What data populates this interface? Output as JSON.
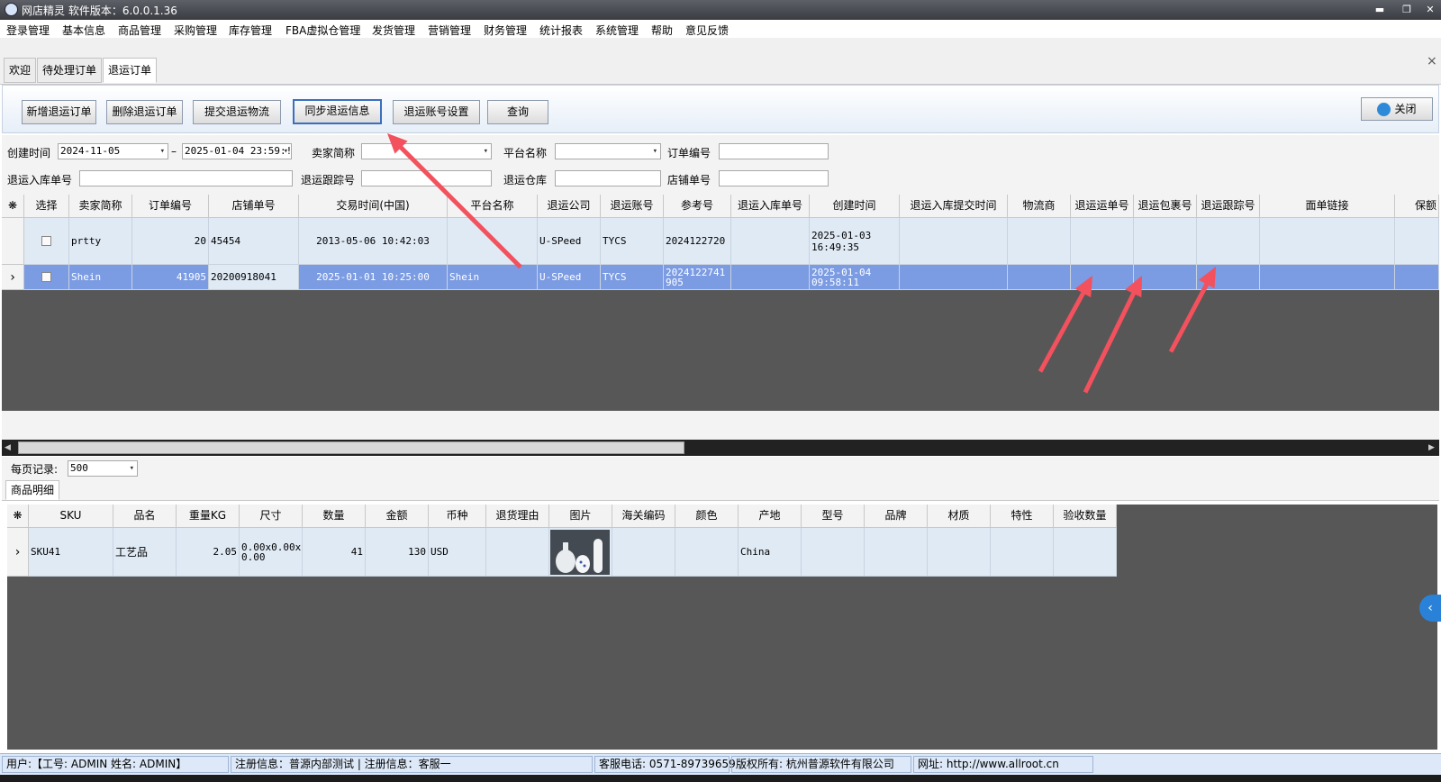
{
  "window": {
    "title": "网店精灵 软件版本：6.0.0.1.36",
    "min": "▬",
    "max": "❐",
    "close": "✕"
  },
  "menu": [
    "登录管理",
    "基本信息",
    "商品管理",
    "采购管理",
    "库存管理",
    "FBA虚拟仓管理",
    "发货管理",
    "营销管理",
    "财务管理",
    "统计报表",
    "系统管理",
    "帮助",
    "意见反馈"
  ],
  "tabs": [
    "欢迎",
    "待处理订单",
    "退运订单"
  ],
  "tab_close": "×",
  "toolbar": {
    "buttons": [
      "新增退运订单",
      "删除退运订单",
      "提交退运物流",
      "同步退运信息",
      "退运账号设置",
      "查询"
    ],
    "close_label": "关闭"
  },
  "filters": {
    "created_label": "创建时间",
    "date_from": "2024-11-05",
    "date_sep": "–",
    "date_to": "2025-01-04 23:59:!",
    "seller_label": "卖家简称",
    "seller_value": "",
    "platform_label": "平台名称",
    "platform_value": "",
    "order_no_label": "订单编号",
    "order_no_value": "",
    "return_in_label": "退运入库单号",
    "return_in_value": "",
    "track_label": "退运跟踪号",
    "track_value": "",
    "warehouse_label": "退运仓库",
    "warehouse_value": "",
    "shop_no_label": "店铺单号",
    "shop_no_value": ""
  },
  "grid": {
    "headers": [
      "选择",
      "卖家简称",
      "订单编号",
      "店铺单号",
      "交易时间(中国)",
      "平台名称",
      "退运公司",
      "退运账号",
      "参考号",
      "退运入库单号",
      "创建时间",
      "退运入库提交时间",
      "物流商",
      "退运运单号",
      "退运包裹号",
      "退运跟踪号",
      "面单链接",
      "保额"
    ],
    "corner": "❋",
    "rows": [
      {
        "marker": "",
        "seller": "prtty",
        "order": "20",
        "shop": "45454",
        "trade_time": "2013-05-06 10:42:03",
        "platform": "",
        "company": "U-SPeed",
        "account": "TYCS",
        "ref": "2024122720",
        "in_no": "",
        "created": "2025-01-03 16:49:35"
      },
      {
        "marker": "›",
        "seller": "Shein",
        "order": "41905",
        "shop": "20200918041",
        "trade_time": "2025-01-01 10:25:00",
        "platform": "Shein",
        "company": "U-SPeed",
        "account": "TYCS",
        "ref": "2024122741 905",
        "in_no": "",
        "created": "2025-01-04 09:58:11"
      }
    ]
  },
  "paging": {
    "label": "每页记录:",
    "value": "500"
  },
  "detail": {
    "tab": "商品明细",
    "headers": [
      "SKU",
      "品名",
      "重量KG",
      "尺寸",
      "数量",
      "金额",
      "币种",
      "退货理由",
      "图片",
      "海关编码",
      "颜色",
      "产地",
      "型号",
      "品牌",
      "材质",
      "特性",
      "验收数量"
    ],
    "row": {
      "marker": "›",
      "sku": "SKU41",
      "name": "工艺品",
      "weight": "2.05",
      "size": "0.00x0.00x 0.00",
      "qty": "41",
      "amount": "130",
      "currency": "USD",
      "origin": "China"
    }
  },
  "status": {
    "user": "用户:【工号: ADMIN  姓名: ADMIN】",
    "reg": "注册信息：普源内部测试 | 注册信息：客服一",
    "phone": "客服电话: 0571-89739659",
    "copyright": "版权所有: 杭州普源软件有限公司",
    "site": "网址: http://www.allroot.cn"
  },
  "colors": {
    "arrow": "#f2515d",
    "selected_row": "#7b9be2",
    "grid_bg": "#575757"
  }
}
